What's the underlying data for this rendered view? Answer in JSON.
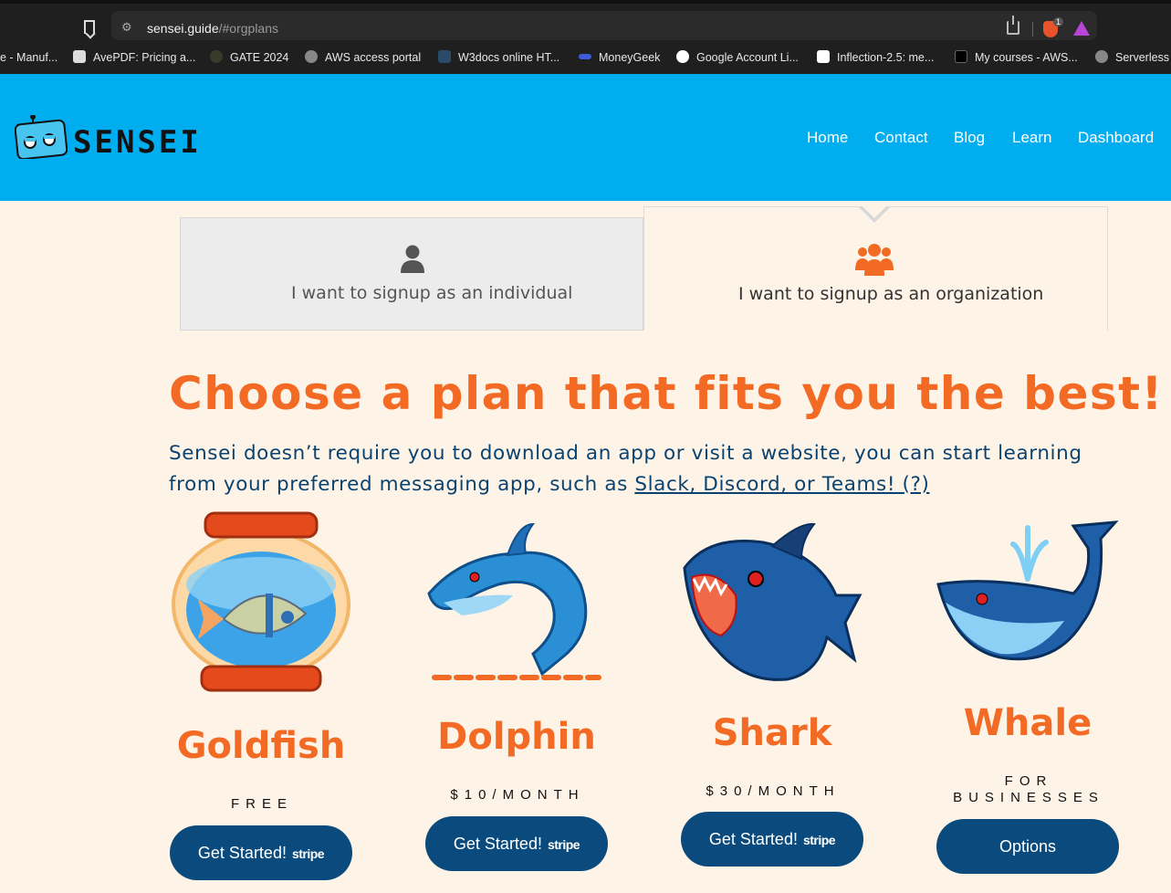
{
  "browser": {
    "url_host": "sensei.guide",
    "url_path": "/#orgplans",
    "brave_count": "1",
    "bookmarks": [
      "e - Manuf...",
      "AvePDF: Pricing a...",
      "GATE 2024",
      "AWS access portal",
      "W3docs online HT...",
      "MoneyGeek",
      "Google Account Li...",
      "Inflection-2.5: me...",
      "My courses - AWS...",
      "Serverless"
    ]
  },
  "header": {
    "logo_text": "SENSEI",
    "nav": [
      "Home",
      "Contact",
      "Blog",
      "Learn",
      "Dashboard"
    ]
  },
  "tabs": {
    "individual": "I want to signup as an individual",
    "organization": "I want to signup as an organization"
  },
  "hero": {
    "title": "Choose a plan that fits you the best!",
    "subtitle": "Sensei doesn’t require you to download an app or visit a website, you can start learning from your preferred messaging app, such as ",
    "subtitle_link": "Slack, Discord, or Teams! (?)"
  },
  "plans": [
    {
      "name": "Goldfish",
      "price": "FREE",
      "button": "Get Started!",
      "badge": "stripe"
    },
    {
      "name": "Dolphin",
      "price": "$10/MONTH",
      "button": "Get Started!",
      "badge": "stripe"
    },
    {
      "name": "Shark",
      "price": "$30/MONTH",
      "button": "Get Started!",
      "badge": "stripe"
    },
    {
      "name": "Whale",
      "price_line1": "FOR",
      "price_line2": "BUSINESSES",
      "button": "Options"
    }
  ],
  "colors": {
    "header_blue": "#00aef0",
    "accent_orange": "#f26a23",
    "navy": "#0a4a7c",
    "background": "#fdf3e6"
  }
}
